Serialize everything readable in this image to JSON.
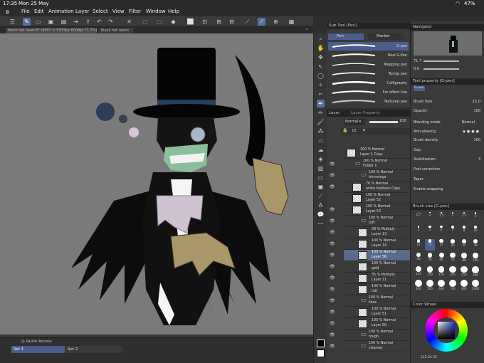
{
  "status": {
    "time": "17:35",
    "date": "Mon 25 May",
    "battery": "47%"
  },
  "menu": [
    "File",
    "Edit",
    "Animation",
    "Layer",
    "Select",
    "View",
    "Filter",
    "Window",
    "Help"
  ],
  "tabs": [
    "black hat raven3* (6997 × 5533px 600dpi 71.7%)",
    "black hat raven"
  ],
  "quick_access": {
    "title": "Quick Access",
    "set1": "Set 1",
    "set2": "Set 2"
  },
  "subtool": {
    "header": "Sub Tool [Pen]",
    "tab_pen": "Pen",
    "tab_marker": "Marker",
    "brushes": [
      "G-pen",
      "Real G-Pen",
      "Mapping pen",
      "Turnip pen",
      "Calligraphy",
      "For effect line",
      "Textured pen"
    ]
  },
  "layer": {
    "header": "Layer",
    "header2": "Layer Property",
    "blend": "Normal",
    "opacity": "100",
    "rows": [
      {
        "pct": "100 % Normal",
        "name": "Layer 1 Copy",
        "type": "layer"
      },
      {
        "pct": "100 % Normal",
        "name": "Folder 1",
        "type": "folder"
      },
      {
        "pct": "100 % Normal",
        "name": "trimmings",
        "type": "folder"
      },
      {
        "pct": "76 % Normal",
        "name": "white feathers Copy",
        "type": "layer"
      },
      {
        "pct": "100 % Normal",
        "name": "Layer 52",
        "type": "layer"
      },
      {
        "pct": "100 % Normal",
        "name": "Layer 53",
        "type": "layer"
      },
      {
        "pct": "100 % Normal",
        "name": "tuft",
        "type": "folder"
      },
      {
        "pct": "28 % Multiply",
        "name": "Layer 13",
        "type": "layer"
      },
      {
        "pct": "100 % Normal",
        "name": "Layer 14",
        "type": "layer"
      },
      {
        "pct": "100 % Normal",
        "name": "Layer 56",
        "type": "layer"
      },
      {
        "pct": "100 % Normal",
        "name": "gold",
        "type": "layer"
      },
      {
        "pct": "35 % Multiply",
        "name": "Layer 11",
        "type": "layer"
      },
      {
        "pct": "100 % Normal",
        "name": "tuft",
        "type": "layer"
      },
      {
        "pct": "100 % Normal",
        "name": "lines",
        "type": "folder"
      },
      {
        "pct": "100 % Normal",
        "name": "Layer 51",
        "type": "layer"
      },
      {
        "pct": "100 % Normal",
        "name": "Layer 50",
        "type": "layer"
      },
      {
        "pct": "100 % Normal",
        "name": "rough",
        "type": "folder"
      },
      {
        "pct": "100 % Normal",
        "name": "cleaned",
        "type": "folder"
      }
    ]
  },
  "navigator": {
    "header": "Navigator",
    "zoom": "71.7",
    "angle": "0.0"
  },
  "tool_property": {
    "header": "Tool property [G-pen]",
    "tab": "G-pen",
    "brush_size_label": "Brush Size",
    "brush_size": "15.0",
    "opacity_label": "Opacity",
    "opacity": "100",
    "blending_label": "Blending mode",
    "blending": "Normal",
    "aa_label": "Anti-aliasing",
    "density_label": "Brush density",
    "density": "100",
    "gap_label": "Gap",
    "stab_label": "Stabilization",
    "stab": "3",
    "post_label": "Post correction",
    "taper_label": "Taper",
    "snap_label": "Enable snapping"
  },
  "brush_size_panel": {
    "header": "Brush size [G-pen]",
    "values": [
      "0.7",
      "1",
      "1.5",
      "2",
      "2.5",
      "3",
      "4",
      "5",
      "6",
      "7",
      "8",
      "10",
      "12",
      "15",
      "17",
      "20",
      "25",
      "30",
      "40",
      "50",
      "60",
      "70",
      "80",
      "100",
      "120",
      "150",
      "170",
      "200",
      "250",
      "300",
      "400",
      "500",
      "600",
      "700",
      "800",
      "1000"
    ]
  },
  "color_wheel": {
    "header": "Color Wheel",
    "r": "212",
    "g": "24",
    "b": "25"
  },
  "colors": {
    "accent": "#5a6fa0",
    "hat": "#000000",
    "face": "#8bbf9c",
    "claw": "#a99669"
  }
}
